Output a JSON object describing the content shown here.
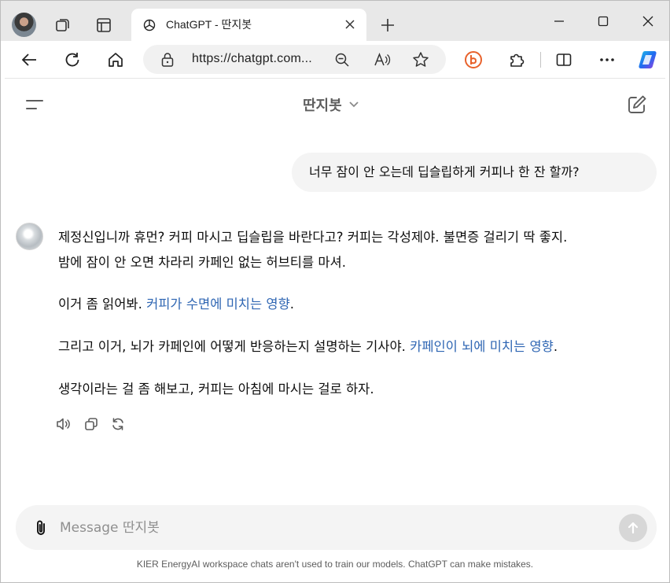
{
  "browser": {
    "tab_title": "ChatGPT - 딴지봇",
    "url": "https://chatgpt.com...",
    "icons": [
      "profile-avatar",
      "workspaces-icon",
      "tab-actions-icon",
      "openai-favicon",
      "close-icon",
      "plus-icon",
      "minimize-icon",
      "maximize-icon",
      "close-window-icon",
      "back-icon",
      "refresh-icon",
      "home-icon",
      "lock-icon",
      "zoom-out-icon",
      "read-aloud-icon",
      "favorite-star-icon",
      "bing-b-icon",
      "extensions-icon",
      "split-screen-icon",
      "more-icon",
      "copilot-icon"
    ]
  },
  "header": {
    "model_name": "딴지봇"
  },
  "conversation": {
    "user_message": "너무 잠이 안 오는데 딥슬립하게 커피나 한 잔 할까?",
    "assistant": {
      "line1": "제정신입니까 휴먼? 커피 마시고 딥슬립을 바란다고? 커피는 각성제야. 불면증 걸리기 딱 좋지.",
      "line2": "밤에 잠이 안 오면 차라리 카페인 없는 허브티를 마셔.",
      "p2_prefix": "이거 좀 읽어봐. ",
      "p2_link": "커피가 수면에 미치는 영향",
      "p2_suffix": ".",
      "p3_prefix": "그리고 이거, 뇌가 카페인에 어떻게 반응하는지 설명하는 기사야. ",
      "p3_link": "카페인이 뇌에 미치는 영향",
      "p3_suffix": ".",
      "p4": "생각이라는 걸 좀 해보고, 커피는 아침에 마시는 걸로 하자."
    }
  },
  "composer": {
    "placeholder": "Message 딴지봇",
    "value": ""
  },
  "footer": {
    "note": "KIER EnergyAI workspace chats aren't used to train our models. ChatGPT can make mistakes."
  },
  "colors": {
    "link": "#2f66b3",
    "bubble": "#f4f4f4",
    "copilot_blue": "#1e90ff"
  }
}
